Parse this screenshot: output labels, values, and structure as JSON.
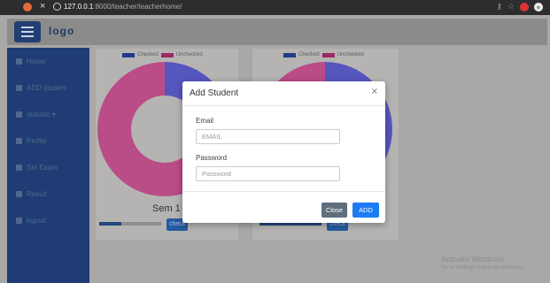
{
  "browser": {
    "url_host": "127.0.0.1",
    "url_path": ":8000/teacher/teacherhome/"
  },
  "app": {
    "logo": "logo"
  },
  "sidebar": {
    "items": [
      {
        "label": "Home",
        "icon": "home-icon"
      },
      {
        "label": "ADD student",
        "icon": "file-icon"
      },
      {
        "label": "statistic ▾",
        "icon": "bar-chart-icon"
      },
      {
        "label": "Profile",
        "icon": "user-icon"
      },
      {
        "label": "Set Exam",
        "icon": "id-card-icon"
      },
      {
        "label": "Result",
        "icon": "gear-icon"
      },
      {
        "label": "logout",
        "icon": "logout-icon"
      }
    ]
  },
  "charts": [
    {
      "legend": [
        "Checked",
        "Unchecked"
      ],
      "label": "Sem 1",
      "button": "check"
    },
    {
      "legend": [
        "Checked",
        "Unchecked"
      ],
      "label": "",
      "button": "check"
    }
  ],
  "chart_data": [
    {
      "type": "pie",
      "categories": [
        "Checked",
        "Unchecked"
      ],
      "values": [
        25,
        75
      ],
      "colors": [
        "#1f1fd0",
        "#c60f74"
      ],
      "title": "Sem 1"
    },
    {
      "type": "pie",
      "categories": [
        "Checked",
        "Unchecked"
      ],
      "values": [
        50,
        50
      ],
      "colors": [
        "#1f1fd0",
        "#c60f74"
      ],
      "title": ""
    }
  ],
  "modal": {
    "title": "Add Student",
    "close_symbol": "×",
    "email_label": "Email",
    "email_placeholder": "EMAIL",
    "password_label": "Password",
    "password_placeholder": "Password",
    "close_button": "Close",
    "add_button": "ADD"
  },
  "watermark": {
    "title": "Activate Windows",
    "subtitle": "Go to Settings to activate Windows."
  },
  "colors": {
    "checked": "#1f1fd0",
    "unchecked": "#c60f74",
    "sidebar": "#1f3d74",
    "primary": "#1c7cf4"
  }
}
